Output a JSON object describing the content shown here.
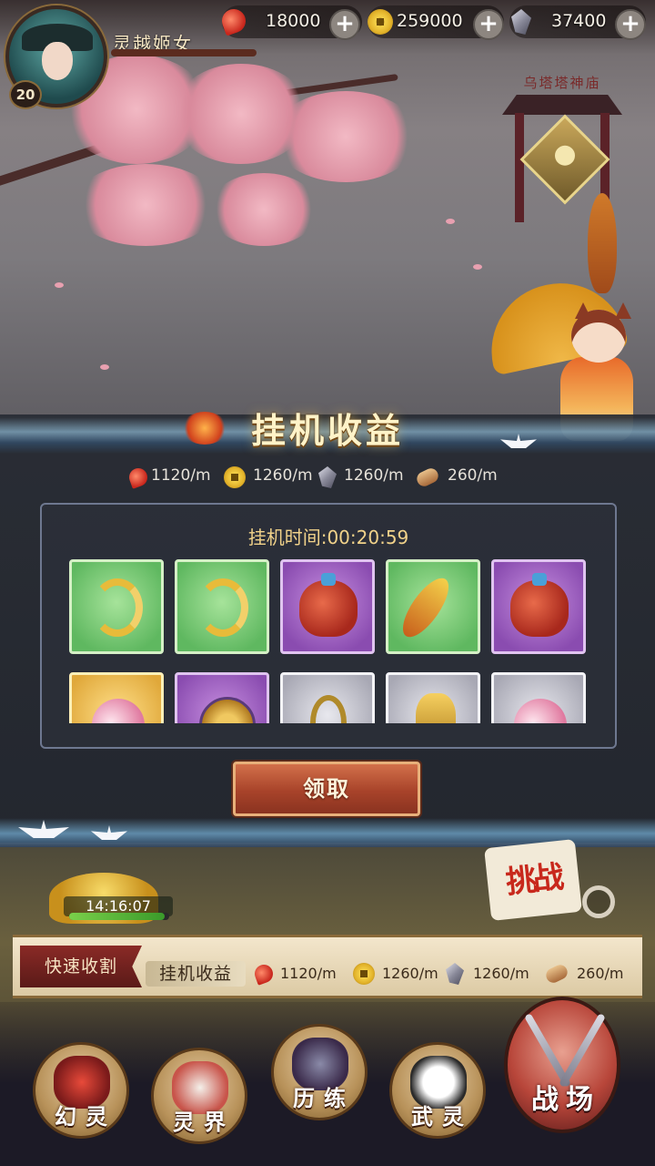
{
  "player": {
    "name": "灵越姬女",
    "level": "20"
  },
  "resources": {
    "spirit": "18000",
    "coin": "259000",
    "crystal": "37400"
  },
  "location": {
    "temple_label": "乌塔塔神庙"
  },
  "idle_panel": {
    "title": "挂机收益",
    "rates": {
      "spirit": "1120/m",
      "coin": "1260/m",
      "crystal": "1260/m",
      "scroll": "260/m"
    },
    "idle_time": "挂机时间:00:20:59",
    "rewards": [
      {
        "icon": "golden-s-icon",
        "rarity": "green"
      },
      {
        "icon": "golden-s-icon",
        "rarity": "green"
      },
      {
        "icon": "lucky-bag-icon",
        "rarity": "purple"
      },
      {
        "icon": "golden-feather-icon",
        "rarity": "green"
      },
      {
        "icon": "lucky-bag-icon",
        "rarity": "purple"
      },
      {
        "icon": "pink-gem-icon",
        "rarity": "gold"
      },
      {
        "icon": "medal-icon",
        "rarity": "purple"
      },
      {
        "icon": "gold-key-icon",
        "rarity": "grey"
      },
      {
        "icon": "gold-bell-icon",
        "rarity": "grey"
      },
      {
        "icon": "pink-gem-icon",
        "rarity": "grey"
      }
    ],
    "claim_label": "领取"
  },
  "scene": {
    "timer": "14:16:07",
    "timer_progress": 0.95,
    "challenge_label": "挑战"
  },
  "strip": {
    "fast_harvest_label": "快速收割",
    "idle_label": "挂机收益",
    "rates": {
      "spirit": "1120/m",
      "coin": "1260/m",
      "crystal": "1260/m",
      "scroll": "260/m"
    }
  },
  "nav": {
    "huanling": "幻灵",
    "lingjie": "灵界",
    "lilian": "历练",
    "wuling": "武灵",
    "battlefield": "战场"
  },
  "colors": {
    "title_gold": "#fff3c8",
    "claim_button": "#a8432a",
    "idle_time_text": "#f1d28a"
  }
}
